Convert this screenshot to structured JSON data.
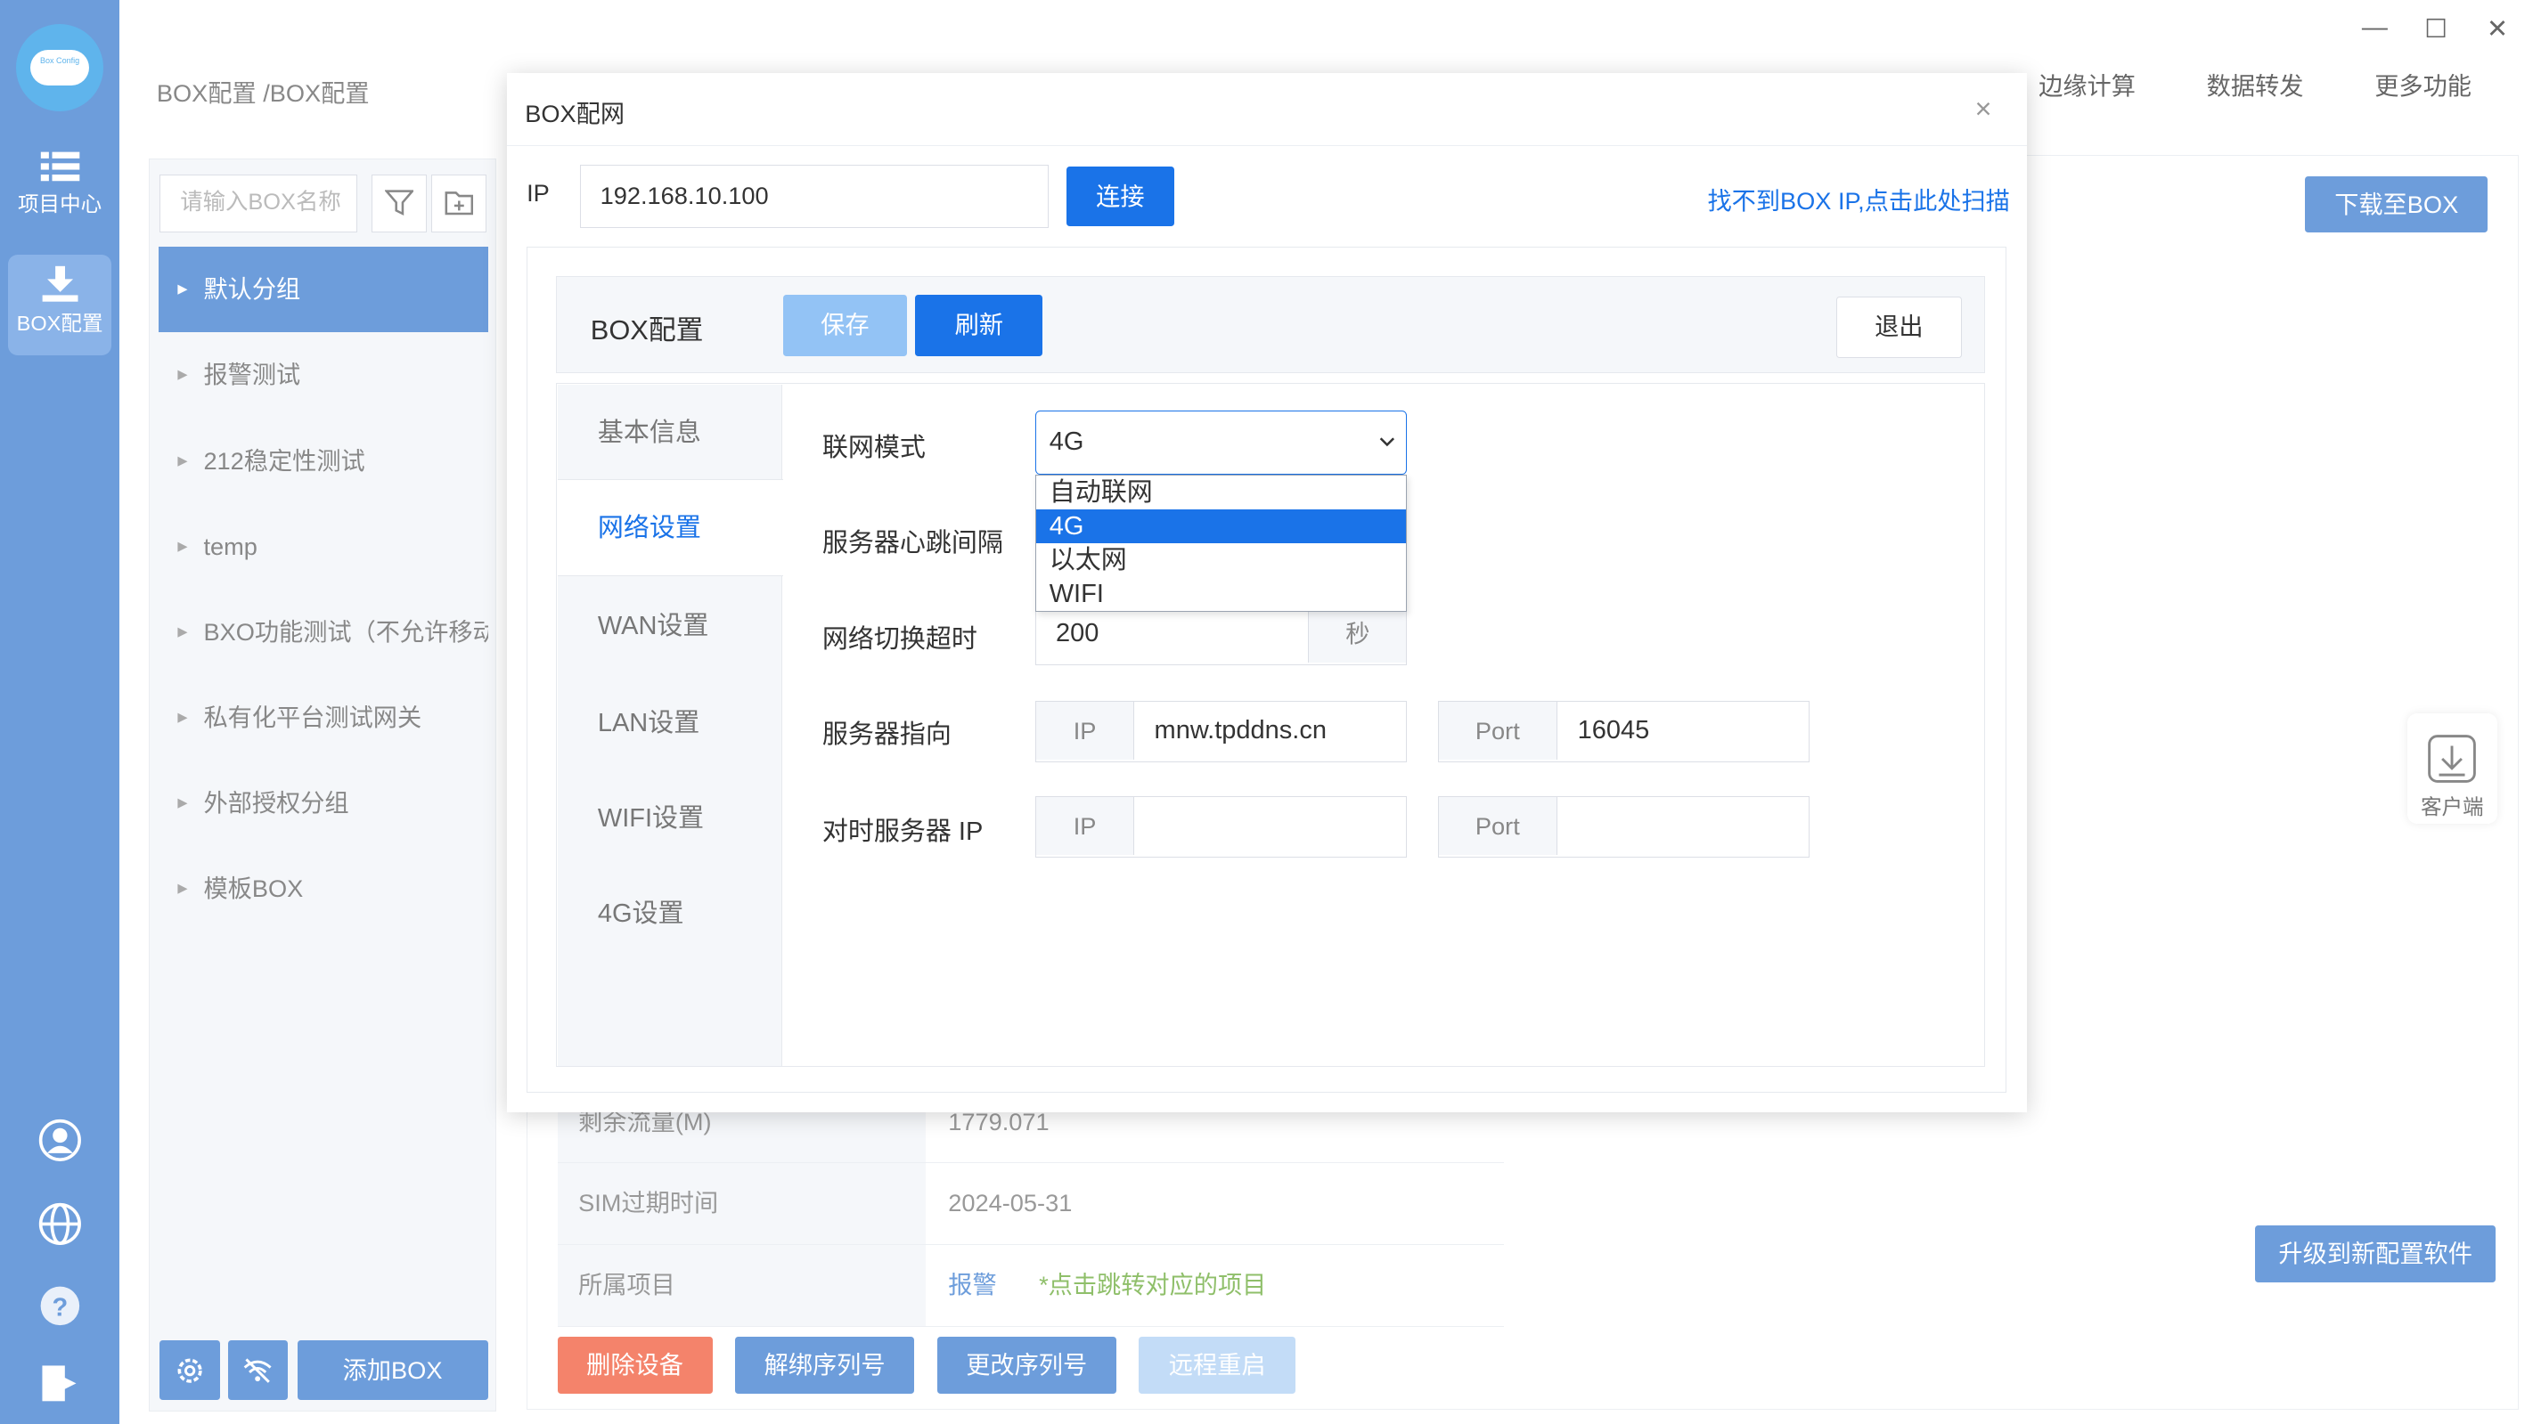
{
  "window": {
    "minimize": "—",
    "maximize": "☐",
    "close": "✕"
  },
  "rail": {
    "logo_text": "Box Config",
    "items": [
      {
        "label": "项目中心"
      },
      {
        "label": "BOX配置"
      }
    ]
  },
  "breadcrumb": "BOX配置 /BOX配置",
  "topnav": {
    "items": [
      "边缘计算",
      "数据转发",
      "更多功能"
    ]
  },
  "groups": {
    "search_placeholder": "请输入BOX名称",
    "items": [
      {
        "label": "默认分组"
      },
      {
        "label": "报警测试"
      },
      {
        "label": "212稳定性测试"
      },
      {
        "label": "temp"
      },
      {
        "label": "BXO功能测试（不允许移动）"
      },
      {
        "label": "私有化平台测试网关"
      },
      {
        "label": "外部授权分组"
      },
      {
        "label": "模板BOX"
      }
    ],
    "add_box": "添加BOX"
  },
  "main": {
    "download_btn": "下载至BOX",
    "rows": [
      {
        "key": "剩余流量(M)",
        "value": "1779.071"
      },
      {
        "key": "SIM过期时间",
        "value": "2024-05-31"
      },
      {
        "key": "所属项目",
        "value": "报警",
        "hint": "*点击跳转对应的项目"
      }
    ],
    "actions": {
      "delete": "删除设备",
      "unbind": "解绑序列号",
      "change": "更改序列号",
      "reboot": "远程重启"
    },
    "client": "客户端",
    "upgrade": "升级到新配置软件"
  },
  "modal": {
    "title": "BOX配网",
    "close": "×",
    "ip_label": "IP",
    "ip_value": "192.168.10.100",
    "connect": "连接",
    "scan_link": "找不到BOX IP,点击此处扫描",
    "cfg_title": "BOX配置",
    "save": "保存",
    "refresh": "刷新",
    "exit": "退出",
    "tabs": [
      {
        "label": "基本信息"
      },
      {
        "label": "网络设置"
      },
      {
        "label": "WAN设置"
      },
      {
        "label": "LAN设置"
      },
      {
        "label": "WIFI设置"
      },
      {
        "label": "4G设置"
      }
    ],
    "form": {
      "net_mode_label": "联网模式",
      "net_mode_value": "4G",
      "net_mode_options": [
        "自动联网",
        "4G",
        "以太网",
        "WIFI"
      ],
      "heartbeat_label": "服务器心跳间隔",
      "switch_timeout_label": "网络切换超时",
      "switch_timeout_value": "200",
      "switch_timeout_unit": "秒",
      "server_label": "服务器指向",
      "server_ip_addon": "IP",
      "server_ip_value": "mnw.tpddns.cn",
      "server_port_addon": "Port",
      "server_port_value": "16045",
      "time_server_label": "对时服务器 IP",
      "time_ip_addon": "IP",
      "time_ip_value": "",
      "time_port_addon": "Port",
      "time_port_value": ""
    }
  },
  "colors": {
    "rail": "#6d9ddb",
    "primary": "#1a73e8",
    "primary_light": "#93c3f5",
    "danger": "#f4836b",
    "hint_green": "#8fbf6a"
  }
}
